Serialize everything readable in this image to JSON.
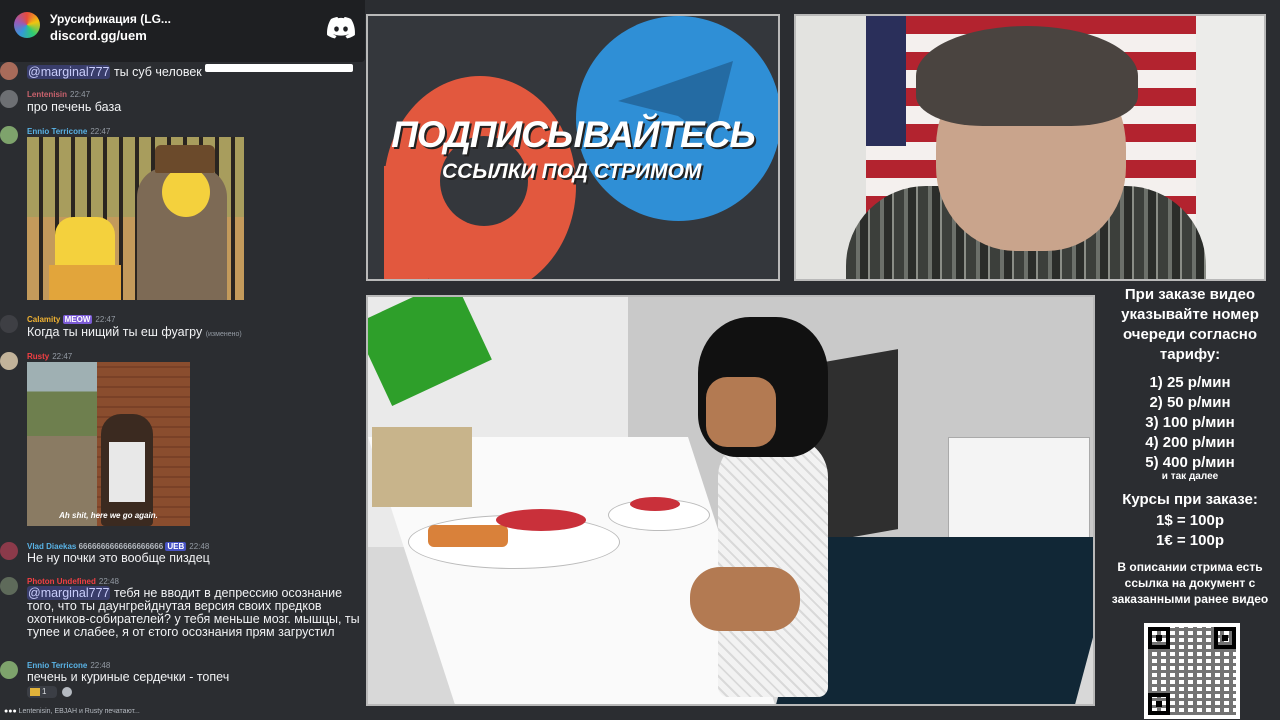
{
  "server": {
    "name": "Урусификация (LG...",
    "invite": "discord.gg/uem"
  },
  "chat": {
    "messages": [
      {
        "text_mention": "@marginal777",
        "text": " ты суб человек"
      },
      {
        "user": "Lentenisin",
        "time": "22:47",
        "text": "про печень база"
      },
      {
        "user": "Ennio Terricone",
        "time": "22:47"
      },
      {
        "user": "Calamity",
        "badge": "MEOW",
        "time": "22:47",
        "text": "Когда ты нищий ты еш фуагру",
        "edited": "(изменено)"
      },
      {
        "user": "Rusty",
        "time": "22:47",
        "meme_caption": "Ah shit, here we go again."
      },
      {
        "user": "Vlad Diaekas",
        "suffix": "6666666666666666666",
        "badge": "UEB",
        "time": "22:48",
        "text": "Не ну почки это вообще пиздец"
      },
      {
        "user": "Photon Undefined",
        "time": "22:48",
        "text_mention": "@marginal777",
        "text": " тебя не вводит в депрессию осознание того, что ты даунгрейднутая версия своих предков охотников-собирателей? у тебя меньше мозг. мышцы, ты тупее и слабее, я от єтого осознания прям загрустил"
      },
      {
        "user": "Ennio Terricone",
        "time": "22:48",
        "text": "печень и куриные сердечки - топеч",
        "reaction_count": "1"
      }
    ],
    "typing": "Lentenisin, EBJAH и Rusty печатают..."
  },
  "promo": {
    "title": "ПОДПИСЫВАЙТЕСЬ",
    "subtitle": "ССЫЛКИ ПОД СТРИМОМ"
  },
  "rules": {
    "heading": "При заказе видео указывайте номер очереди согласно тарифу:",
    "tariffs": [
      "1) 25 р/мин",
      "2) 50 р/мин",
      "3) 100 р/мин",
      "4) 200 р/мин",
      "5) 400 р/мин"
    ],
    "tariffs_more": "и так далее",
    "courses_heading": "Курсы при заказе:",
    "rate_usd": "1$ = 100р",
    "rate_eur": "1€ = 100р",
    "description_note": "В описании стрима есть ссылка на документ с заказанными ранее видео"
  },
  "colors": {
    "background": "#2b2d31",
    "mention_bg": "#3b3f7a",
    "discord_blurple": "#5865f2",
    "patreon": "#e2583e",
    "telegram": "#2f8fd6"
  }
}
